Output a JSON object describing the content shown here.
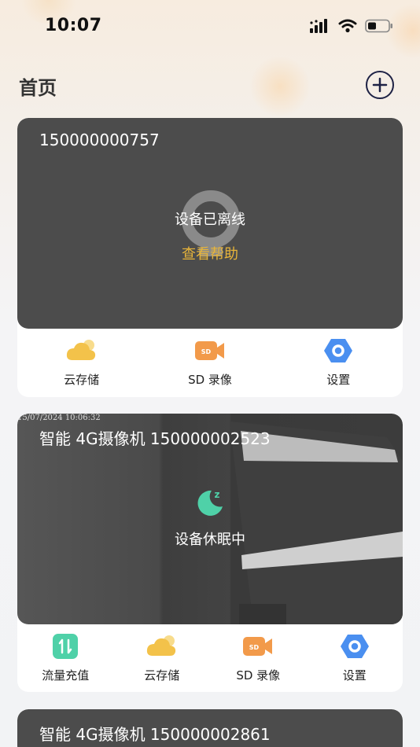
{
  "status_bar": {
    "time": "10:07"
  },
  "header": {
    "title": "首页"
  },
  "cards": [
    {
      "device_name": "150000000757",
      "status": "设备已离线",
      "help_link": "查看帮助",
      "actions": [
        {
          "label": "云存储",
          "icon": "cloud-icon"
        },
        {
          "label": "SD 录像",
          "icon": "sd-camera-icon"
        },
        {
          "label": "设置",
          "icon": "settings-hex-icon"
        }
      ]
    },
    {
      "device_name": "智能 4G摄像机 150000002523",
      "timestamp": "15/07/2024 10:06:32",
      "status": "设备休眠中",
      "actions": [
        {
          "label": "流量充值",
          "icon": "data-recharge-icon"
        },
        {
          "label": "云存储",
          "icon": "cloud-icon"
        },
        {
          "label": "SD 录像",
          "icon": "sd-camera-icon"
        },
        {
          "label": "设置",
          "icon": "settings-hex-icon"
        }
      ]
    },
    {
      "device_name": "智能 4G摄像机 150000002861"
    }
  ],
  "colors": {
    "card_video_bg": "#4c4c4c",
    "help_link": "#e8b53a",
    "cloud": "#f3c24a",
    "sd": "#f29a4a",
    "settings": "#4a8ff0",
    "recharge": "#4fd1a8",
    "sleep": "#4fd1a8"
  }
}
